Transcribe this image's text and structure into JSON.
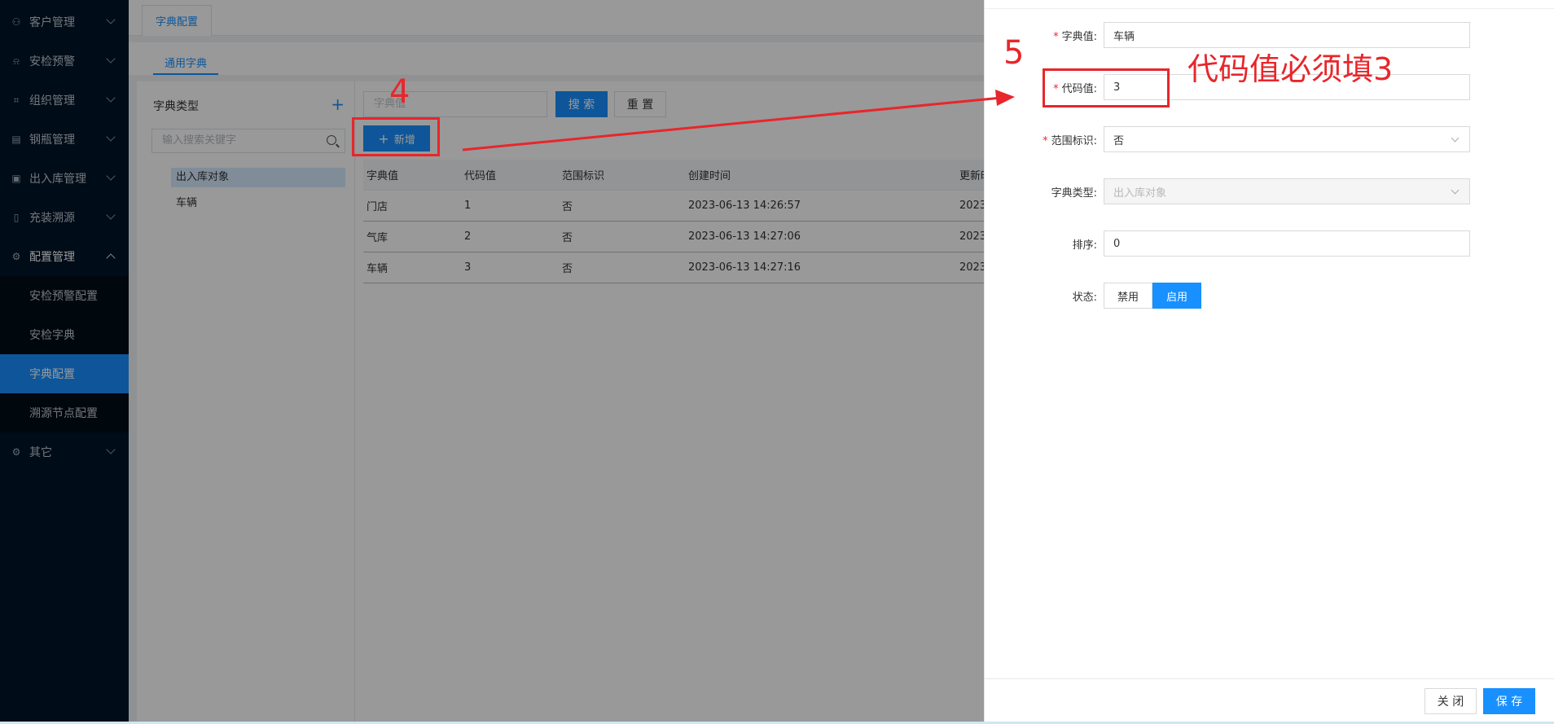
{
  "sidebar": {
    "items": [
      {
        "label": "客户管理",
        "icon": "users-icon"
      },
      {
        "label": "安检预警",
        "icon": "alarm-icon"
      },
      {
        "label": "组织管理",
        "icon": "org-icon"
      },
      {
        "label": "钢瓶管理",
        "icon": "cylinder-icon"
      },
      {
        "label": "出入库管理",
        "icon": "warehouse-icon"
      },
      {
        "label": "充装溯源",
        "icon": "document-icon"
      },
      {
        "label": "配置管理",
        "icon": "gear-icon"
      }
    ],
    "sub_items": [
      "安检预警配置",
      "安检字典",
      "字典配置",
      "溯源节点配置"
    ],
    "active_sub": "字典配置",
    "last_item": {
      "label": "其它",
      "icon": "gear-icon"
    }
  },
  "tabbar": {
    "tab": "字典配置"
  },
  "subtab": "通用字典",
  "tree": {
    "title": "字典类型",
    "search_placeholder": "输入搜索关键字",
    "nodes": [
      "出入库对象",
      "车辆"
    ]
  },
  "toolbar": {
    "query_placeholder": "字典值",
    "search_label": "搜 索",
    "reset_label": "重 置",
    "add_label": "新增"
  },
  "table": {
    "headers": [
      "字典值",
      "代码值",
      "范围标识",
      "创建时间",
      "更新时"
    ],
    "rows": [
      [
        "门店",
        "1",
        "否",
        "2023-06-13 14:26:57",
        "2023-"
      ],
      [
        "气库",
        "2",
        "否",
        "2023-06-13 14:27:06",
        "2023-"
      ],
      [
        "车辆",
        "3",
        "否",
        "2023-06-13 14:27:16",
        "2023-"
      ]
    ]
  },
  "drawer": {
    "fields": {
      "dict_value": {
        "label": "字典值:",
        "value": "车辆"
      },
      "code_value": {
        "label": "代码值:",
        "value": "3"
      },
      "range_flag": {
        "label": "范围标识:",
        "value": "否"
      },
      "dict_type": {
        "label": "字典类型:",
        "value": "出入库对象"
      },
      "sort": {
        "label": "排序:",
        "value": "0"
      },
      "status": {
        "label": "状态:",
        "off": "禁用",
        "on": "启用"
      }
    },
    "close_label": "关 闭",
    "save_label": "保 存"
  },
  "annotations": {
    "step4": "4",
    "step5": "5",
    "note": "代码值必须填3",
    "color": "#e8262b"
  }
}
